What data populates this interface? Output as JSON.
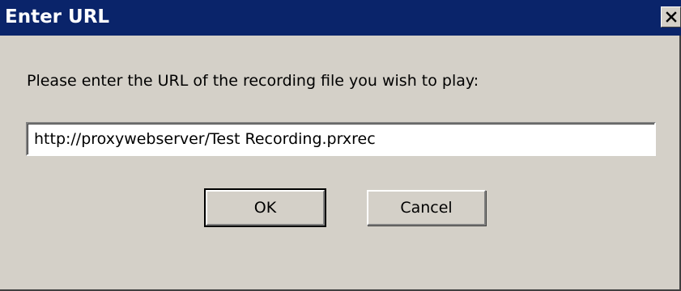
{
  "window": {
    "title": "Enter URL"
  },
  "dialog": {
    "prompt": "Please enter the URL of the recording file you wish to play:",
    "url_value": "http://proxywebserver/Test Recording.prxrec",
    "ok_label": "OK",
    "cancel_label": "Cancel"
  },
  "icons": {
    "close": "close-icon"
  },
  "colors": {
    "titlebar": "#0a246a",
    "dialog_bg": "#d4d0c8",
    "input_bg": "#ffffff"
  }
}
